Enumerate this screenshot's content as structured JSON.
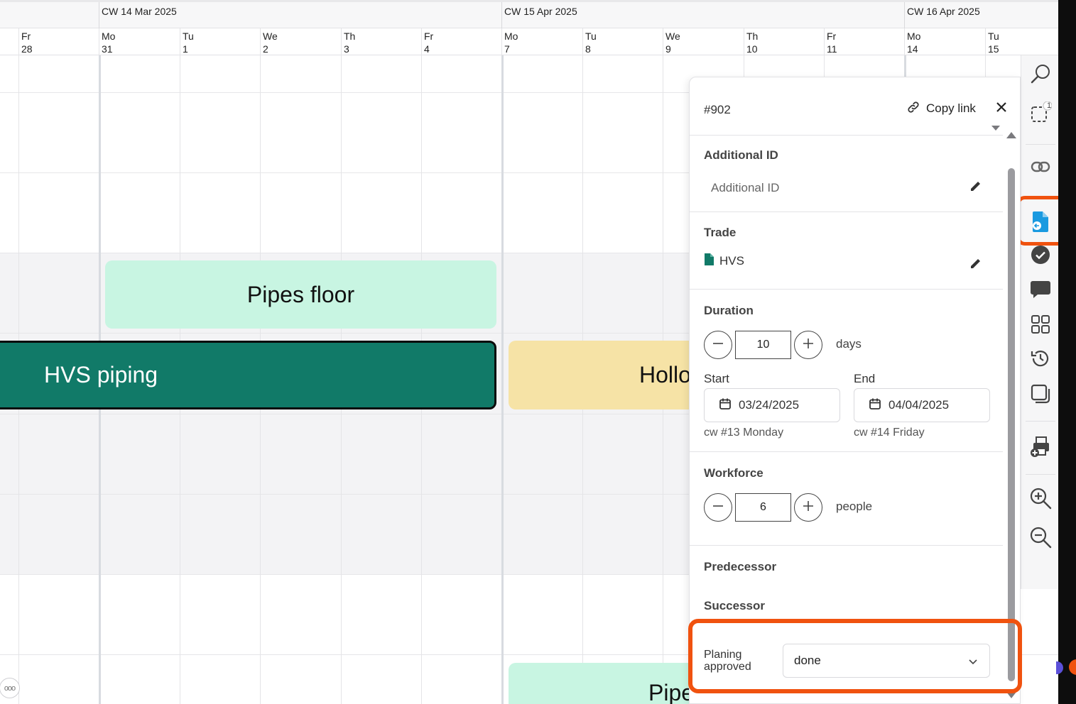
{
  "timeline": {
    "weeks": [
      {
        "label": "CW 14 Mar 2025"
      },
      {
        "label": "CW 15 Apr 2025"
      },
      {
        "label": "CW 16 Apr 2025"
      }
    ],
    "days": [
      {
        "dow": "Fr",
        "num": "28"
      },
      {
        "dow": "Mo",
        "num": "31"
      },
      {
        "dow": "Tu",
        "num": "1"
      },
      {
        "dow": "We",
        "num": "2"
      },
      {
        "dow": "Th",
        "num": "3"
      },
      {
        "dow": "Fr",
        "num": "4"
      },
      {
        "dow": "Mo",
        "num": "7"
      },
      {
        "dow": "Tu",
        "num": "8"
      },
      {
        "dow": "We",
        "num": "9"
      },
      {
        "dow": "Th",
        "num": "10"
      },
      {
        "dow": "Fr",
        "num": "11"
      },
      {
        "dow": "Mo",
        "num": "14"
      },
      {
        "dow": "Tu",
        "num": "15"
      }
    ],
    "tasks": {
      "pipes_floor": "Pipes floor",
      "hvs_piping": "HVS piping",
      "hollow": "Hollo",
      "pipes_floor_bottom": "Pipes floor"
    },
    "more_label": "ooo"
  },
  "panel": {
    "id": "#902",
    "copy_link": "Copy link",
    "additional_id": {
      "title": "Additional ID",
      "placeholder": "Additional ID"
    },
    "trade": {
      "title": "Trade",
      "value": "HVS",
      "icon_color": "#117a68"
    },
    "duration": {
      "title": "Duration",
      "value": "10",
      "unit": "days"
    },
    "start": {
      "label": "Start",
      "date": "03/24/2025",
      "hint": "cw #13 Monday"
    },
    "end": {
      "label": "End",
      "date": "04/04/2025",
      "hint": "cw #14 Friday"
    },
    "workforce": {
      "title": "Workforce",
      "value": "6",
      "unit": "people"
    },
    "predecessor": {
      "title": "Predecessor"
    },
    "successor": {
      "title": "Successor"
    },
    "planning_approved": {
      "label_line1": "Planing",
      "label_line2": "approved",
      "value": "done"
    }
  },
  "toolbar": {
    "selection_badge": "1",
    "icons": [
      "search-icon",
      "selection-icon",
      "link-icon",
      "document-icon",
      "check-circle-icon",
      "comment-icon",
      "grid-icon",
      "history-icon",
      "layers-icon",
      "print-add-icon",
      "zoom-in-icon",
      "zoom-out-icon"
    ]
  },
  "colors": {
    "accent": "#1a9ae0",
    "highlight": "#f0520f",
    "task_mint": "#c8f5e2",
    "task_teal": "#117a68",
    "task_yellow": "#f6e3a6"
  }
}
